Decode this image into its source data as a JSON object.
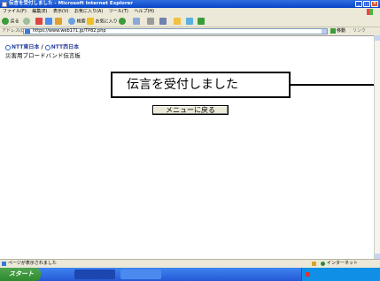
{
  "window": {
    "title": "伝言を受付しました - Microsoft Internet Explorer"
  },
  "menubar": {
    "items": [
      "ファイル(F)",
      "編集(E)",
      "表示(V)",
      "お気に入り(A)",
      "ツール(T)",
      "ヘルプ(H)"
    ]
  },
  "toolbar": {
    "back_label": "戻る",
    "search_label": "検索",
    "favorites_label": "お気に入り"
  },
  "addressbar": {
    "label": "アドレス(D)",
    "url": "https://www.web171.jp/TP82.php",
    "go_label": "移動",
    "links_label": "リンク"
  },
  "page": {
    "logo_primary": "NTT東日本",
    "logo_secondary": "NTT西日本",
    "board_title": "災害用ブロードバンド伝言板",
    "message": "伝言を受付しました",
    "back_to_menu": "メニューに戻る"
  },
  "statusbar": {
    "text": "ページが表示されました",
    "zone": "インターネット"
  },
  "taskbar": {
    "start_label": "スタート"
  }
}
